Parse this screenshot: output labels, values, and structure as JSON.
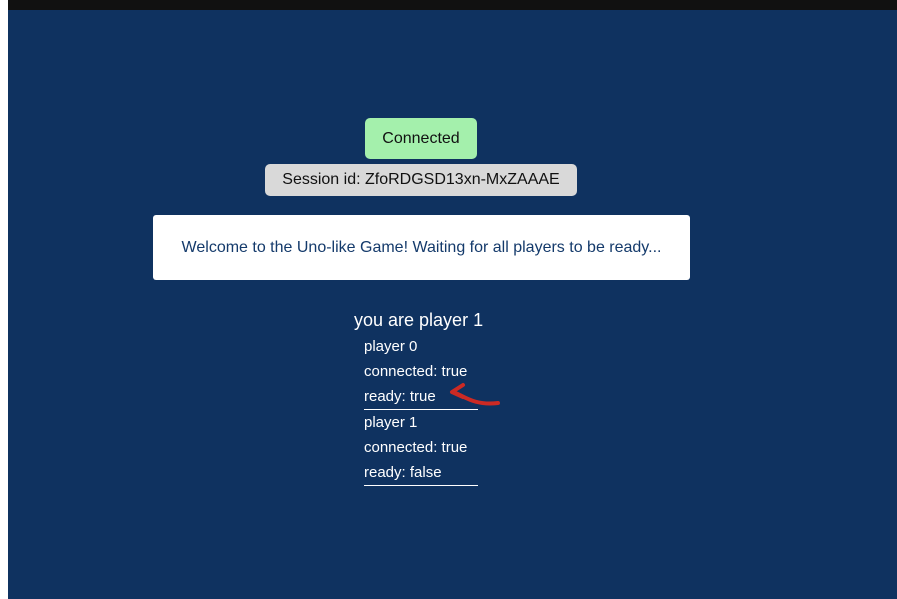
{
  "status": {
    "connection_label": "Connected",
    "session_label": "Session id: ZfoRDGSD13xn-MxZAAAE"
  },
  "message": {
    "text": "Welcome to the Uno-like Game! Waiting for all players to be ready..."
  },
  "player": {
    "header": "you are player 1",
    "entries": [
      {
        "name": "player 0",
        "connected": "connected: true",
        "ready": "ready: true"
      },
      {
        "name": "player 1",
        "connected": "connected: true",
        "ready": "ready: false"
      }
    ]
  },
  "colors": {
    "background": "#0f3260",
    "connected_badge": "#a4f0ac",
    "session_badge": "#d9d9d9",
    "message_text": "#143a6b",
    "annotation": "#cc2a24"
  },
  "annotation": {
    "icon": "red-hand-drawn-arrow-icon"
  }
}
